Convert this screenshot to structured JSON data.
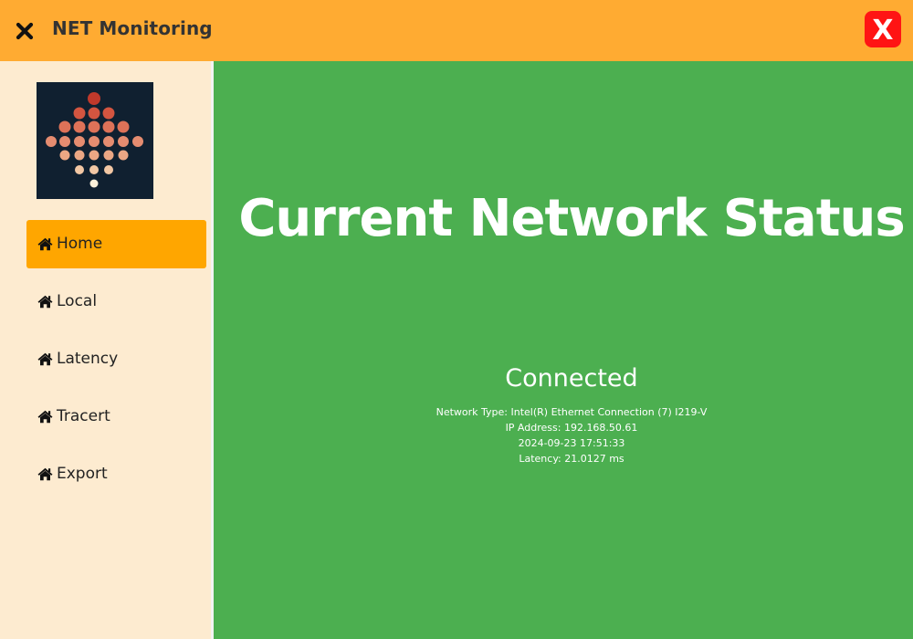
{
  "header": {
    "title": "NET Monitoring",
    "menu_icon": "close-x-icon",
    "exit_label": "X",
    "bar_color": "#ffab32",
    "exit_color": "#ff1414"
  },
  "sidebar": {
    "logo_icon": "network-signal-logo",
    "items": [
      {
        "label": "Home",
        "icon": "home-icon",
        "active": true
      },
      {
        "label": "Local",
        "icon": "home-icon",
        "active": false
      },
      {
        "label": "Latency",
        "icon": "home-icon",
        "active": false
      },
      {
        "label": "Tracert",
        "icon": "home-icon",
        "active": false
      },
      {
        "label": "Export",
        "icon": "home-icon",
        "active": false
      }
    ],
    "background": "#fdebd0",
    "active_color": "#ffa600"
  },
  "main": {
    "title": "Current Network Status",
    "status": "Connected",
    "network_type": "Network Type: Intel(R) Ethernet Connection (7) I219-V",
    "ip_address": "IP Address: 192.168.50.61",
    "timestamp": "2024-09-23 17:51:33",
    "latency": "Latency: 21.0127 ms",
    "background": "#4caf50"
  }
}
